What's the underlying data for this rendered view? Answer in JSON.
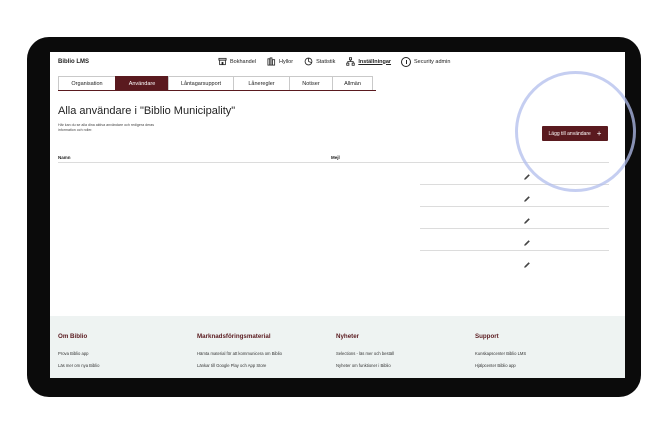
{
  "app": {
    "brand": "Biblio LMS"
  },
  "topnav": [
    {
      "label": "Bokhandel",
      "icon": "store-icon"
    },
    {
      "label": "Hyllor",
      "icon": "shelves-icon"
    },
    {
      "label": "Statistik",
      "icon": "pie-chart-icon"
    },
    {
      "label": "Inställningar",
      "icon": "network-icon",
      "active": true
    }
  ],
  "security": {
    "label": "Security admin"
  },
  "tabs": [
    {
      "label": "Organisation"
    },
    {
      "label": "Användare",
      "active": true
    },
    {
      "label": "Låntagarsupport"
    },
    {
      "label": "Låneregler"
    },
    {
      "label": "Notiser"
    },
    {
      "label": "Allmän"
    }
  ],
  "page": {
    "title": "Alla användare i \"Biblio Municipality\"",
    "description": "Här kan du se alla dina aktiva användare och redigera deras information och roller.",
    "add_button": "Lägg till användare"
  },
  "table": {
    "headers": {
      "name": "Namn",
      "email": "Mejl"
    },
    "rows": [
      {},
      {},
      {},
      {},
      {}
    ]
  },
  "footer": [
    {
      "title": "Om Biblio",
      "links": [
        "Prova Biblio app",
        "Läs mer om nya Biblio"
      ]
    },
    {
      "title": "Marknadsföringsmaterial",
      "links": [
        "Hämta material för att kommunicera om Biblio",
        "Länkar till Google Play och App Store"
      ]
    },
    {
      "title": "Nyheter",
      "links": [
        "Selections - läs mer och beställ",
        "Nyheter om funktioner i Biblio"
      ]
    },
    {
      "title": "Support",
      "links": [
        "Kunskapscenter Biblio LMS",
        "Hjälpcenter Biblio app"
      ]
    }
  ],
  "colors": {
    "accent": "#5a1a1f",
    "footer_bg": "#eef3f2",
    "highlight": "#b2beec"
  }
}
